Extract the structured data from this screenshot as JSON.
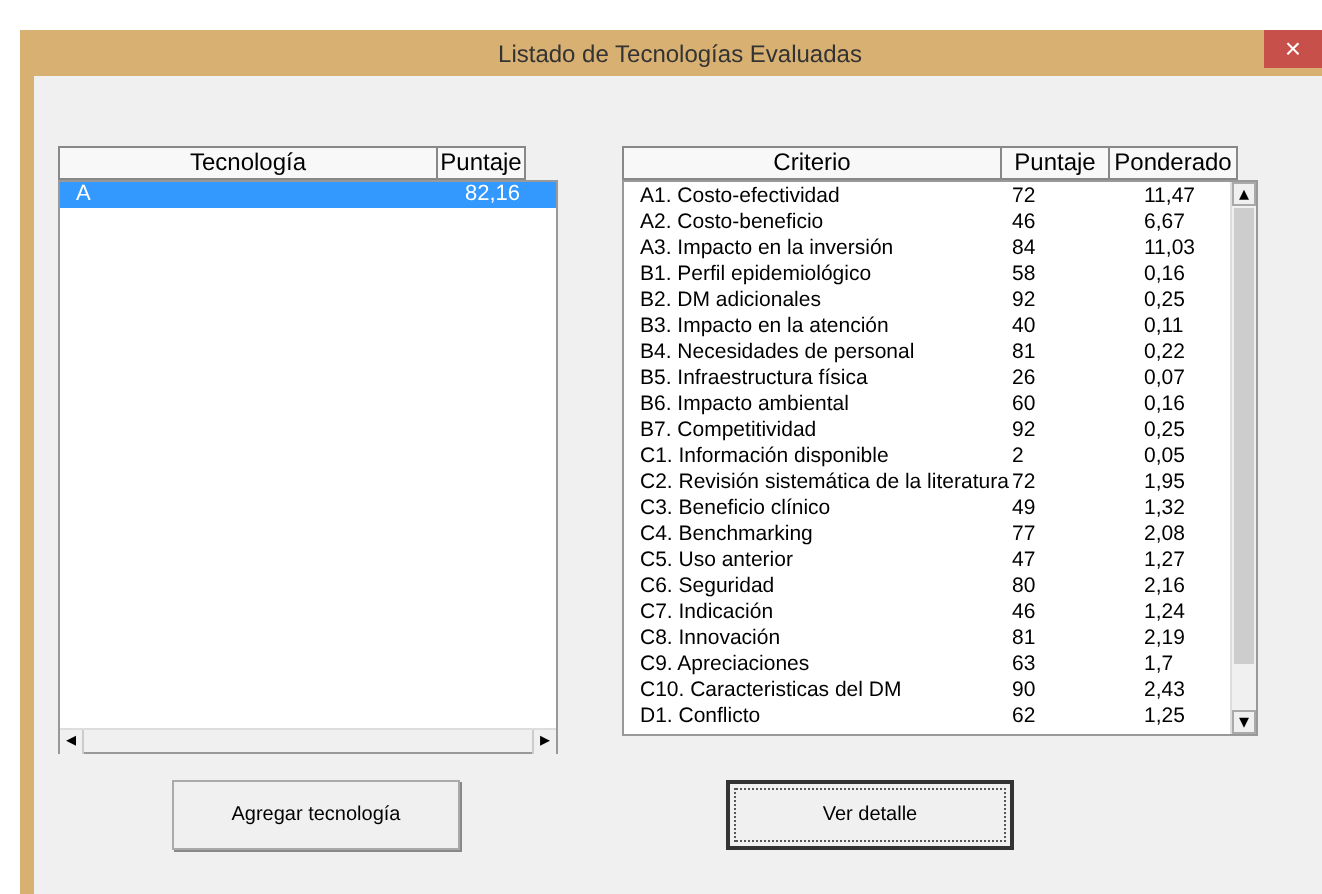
{
  "window": {
    "title": "Listado de Tecnologías Evaluadas",
    "close": "×"
  },
  "technologies": {
    "columns": [
      "Tecnología",
      "Puntaje"
    ],
    "rows": [
      {
        "name": "A",
        "score": "82,16",
        "selected": true
      }
    ],
    "scroll_left": "◂",
    "scroll_right": "▸"
  },
  "criteria": {
    "columns": [
      "Criterio",
      "Puntaje",
      "Ponderado"
    ],
    "rows": [
      {
        "criterion": "A1. Costo-efectividad",
        "score": "72",
        "weighted": "11,47"
      },
      {
        "criterion": "A2. Costo-beneficio",
        "score": "46",
        "weighted": "6,67"
      },
      {
        "criterion": "A3. Impacto en la inversión",
        "score": "84",
        "weighted": "11,03"
      },
      {
        "criterion": "B1. Perfil epidemiológico",
        "score": "58",
        "weighted": "0,16"
      },
      {
        "criterion": "B2. DM adicionales",
        "score": "92",
        "weighted": "0,25"
      },
      {
        "criterion": "B3. Impacto en la atención",
        "score": "40",
        "weighted": "0,11"
      },
      {
        "criterion": "B4. Necesidades de personal",
        "score": "81",
        "weighted": "0,22"
      },
      {
        "criterion": "B5. Infraestructura física",
        "score": "26",
        "weighted": "0,07"
      },
      {
        "criterion": "B6. Impacto ambiental",
        "score": "60",
        "weighted": "0,16"
      },
      {
        "criterion": "B7. Competitividad",
        "score": "92",
        "weighted": "0,25"
      },
      {
        "criterion": "C1. Información disponible",
        "score": "2",
        "weighted": "0,05"
      },
      {
        "criterion": "C2. Revisión sistemática de la literatura",
        "score": "72",
        "weighted": "1,95"
      },
      {
        "criterion": "C3. Beneficio clínico",
        "score": "49",
        "weighted": "1,32"
      },
      {
        "criterion": "C4. Benchmarking",
        "score": "77",
        "weighted": "2,08"
      },
      {
        "criterion": "C5. Uso anterior",
        "score": "47",
        "weighted": "1,27"
      },
      {
        "criterion": "C6. Seguridad",
        "score": "80",
        "weighted": "2,16"
      },
      {
        "criterion": "C7. Indicación",
        "score": "46",
        "weighted": "1,24"
      },
      {
        "criterion": "C8. Innovación",
        "score": "81",
        "weighted": "2,19"
      },
      {
        "criterion": "C9. Apreciaciones",
        "score": "63",
        "weighted": "1,7"
      },
      {
        "criterion": "C10. Caracteristicas del DM",
        "score": "90",
        "weighted": "2,43"
      },
      {
        "criterion": "D1. Conflicto",
        "score": "62",
        "weighted": "1,25"
      }
    ],
    "scroll_up": "▴",
    "scroll_down": "▾"
  },
  "buttons": [
    {
      "label": "Agregar tecnología",
      "focused": false
    },
    {
      "label": "Ver detalle",
      "focused": true
    }
  ]
}
